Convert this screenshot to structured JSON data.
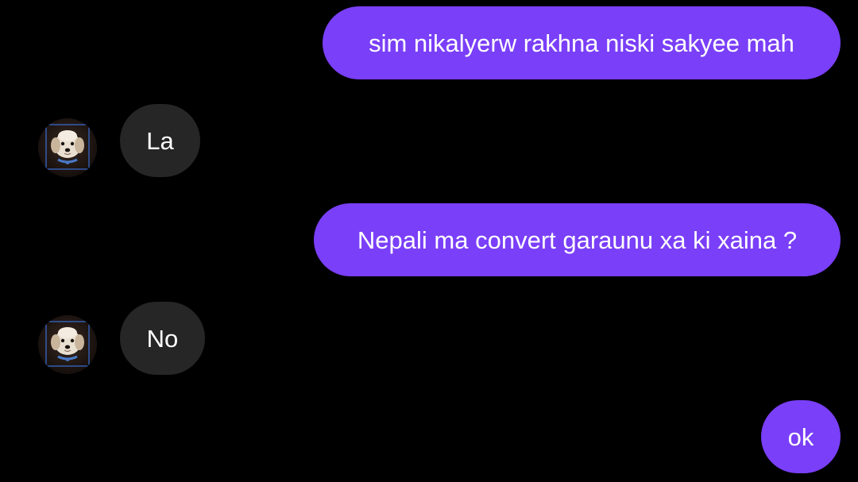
{
  "conversation": {
    "messages": [
      {
        "direction": "outgoing",
        "text": "sim nikalyerw rakhna niski sakyee mah"
      },
      {
        "direction": "incoming",
        "text": "La",
        "avatar_icon": "dog-avatar-icon"
      },
      {
        "direction": "outgoing",
        "text": "Nepali ma convert garaunu xa ki xaina ?"
      },
      {
        "direction": "incoming",
        "text": "No",
        "avatar_icon": "dog-avatar-icon"
      },
      {
        "direction": "outgoing",
        "text": "ok"
      }
    ]
  },
  "colors": {
    "background": "#000000",
    "outgoing_bubble": "#7a3ff8",
    "incoming_bubble": "#262626",
    "text": "#ffffff"
  }
}
